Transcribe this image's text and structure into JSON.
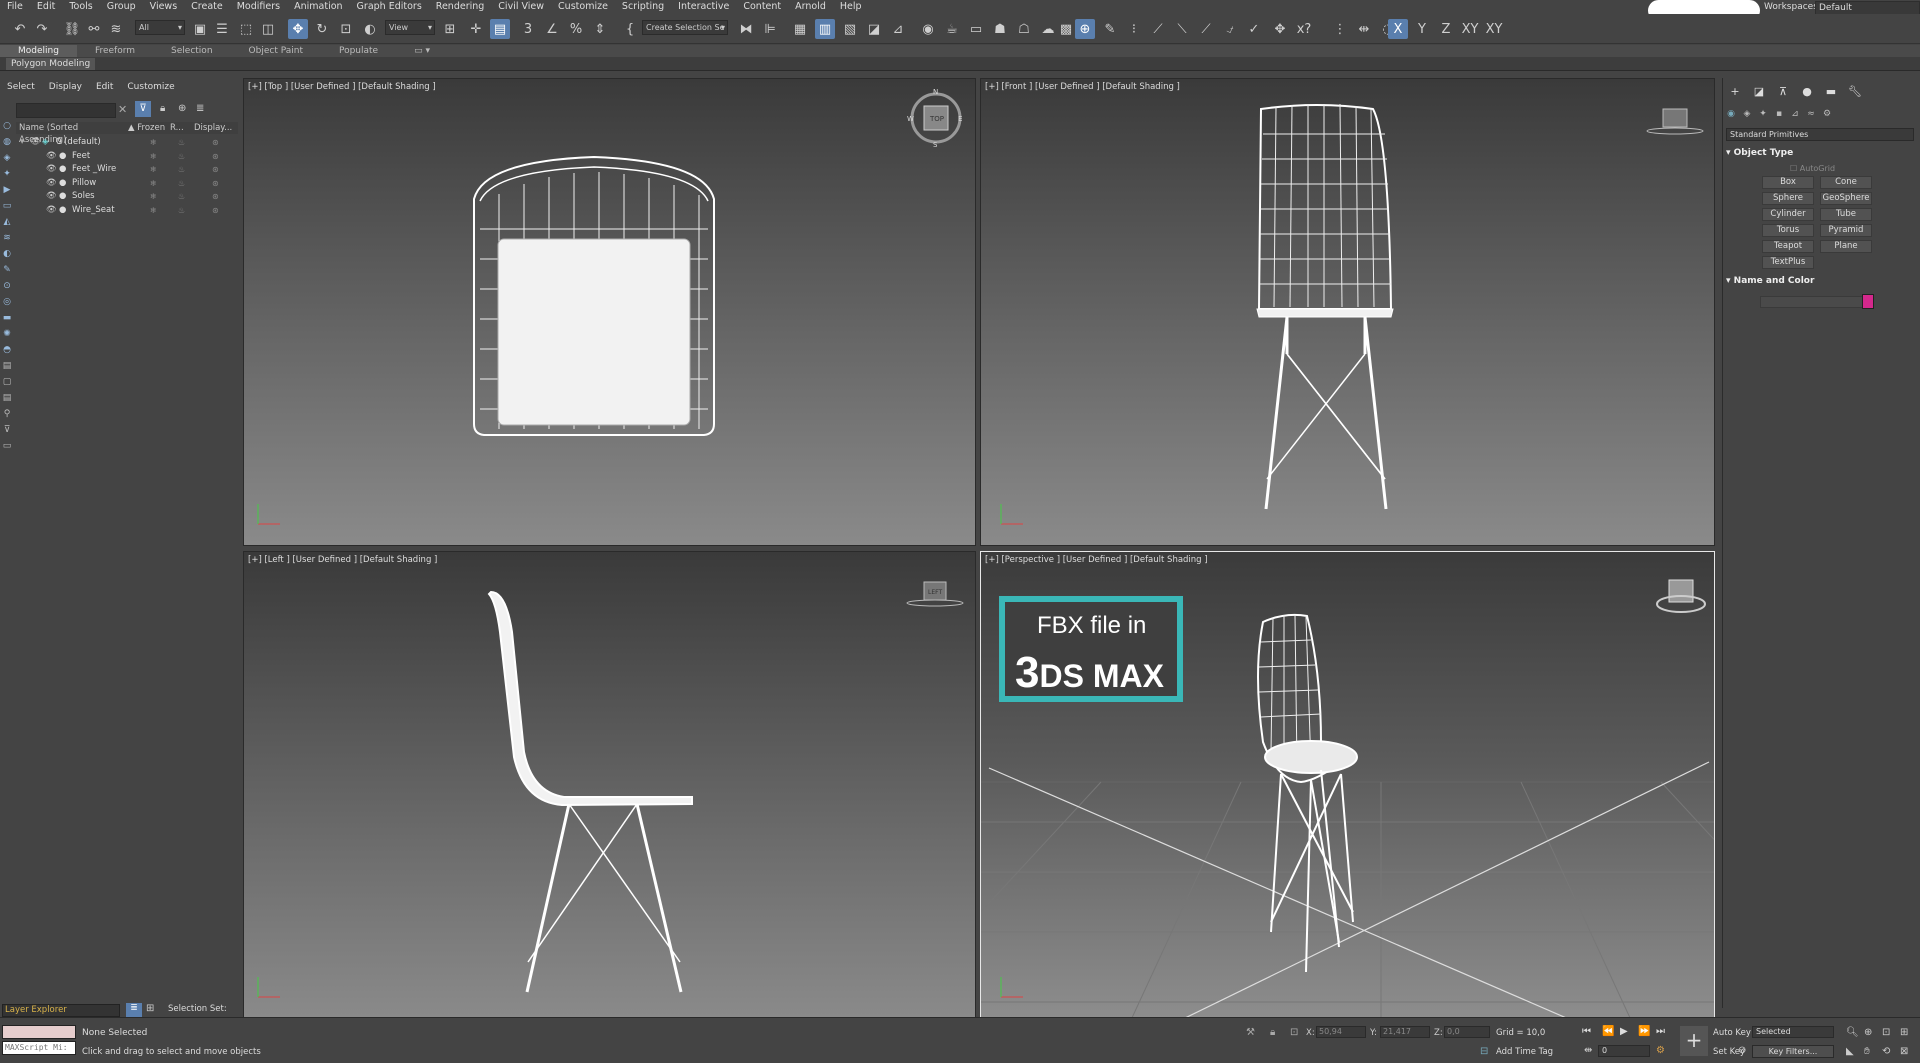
{
  "menu": [
    "File",
    "Edit",
    "Tools",
    "Group",
    "Views",
    "Create",
    "Modifiers",
    "Animation",
    "Graph Editors",
    "Rendering",
    "Civil View",
    "Customize",
    "Scripting",
    "Interactive",
    "Content",
    "Arnold",
    "Help"
  ],
  "workspaces_label": "Workspaces:",
  "workspace_value": "Default",
  "toolbar": {
    "selection_filter": "All",
    "ref_coord": "View",
    "selection_set": "Create Selection Se",
    "axis_x": "X",
    "axis_y": "Y",
    "axis_z": "Z",
    "axis_xy": "XY",
    "axis_xy2": "XY"
  },
  "ribbon": {
    "tabs": [
      "Modeling",
      "Freeform",
      "Selection",
      "Object Paint",
      "Populate"
    ],
    "sub_label": "Polygon Modeling"
  },
  "scene_explorer": {
    "menu": [
      "Select",
      "Display",
      "Edit",
      "Customize"
    ],
    "columns": [
      "Name (Sorted Ascending)",
      "▲ Frozen",
      "R...",
      "Display..."
    ],
    "rows": [
      {
        "name": "0 (default)"
      },
      {
        "name": "Feet"
      },
      {
        "name": "Feet _Wire"
      },
      {
        "name": "Pillow"
      },
      {
        "name": "Soles"
      },
      {
        "name": "Wire_Seat"
      }
    ],
    "layer_explorer": "Layer Explorer",
    "selection_set_label": "Selection Set:"
  },
  "viewports": {
    "top": "[+] [Top ] [User Defined ] [Default Shading ]",
    "front": "[+] [Front ] [User Defined ] [Default Shading ]",
    "left": "[+] [Left ] [User Defined ] [Default Shading ]",
    "perspective": "[+] [Perspective ] [User Defined ] [Default Shading ]",
    "viewcube_top": "TOP",
    "viewcube_left": "LEFT",
    "compass": [
      "N",
      "S",
      "E",
      "W"
    ]
  },
  "overlay": {
    "line1": "FBX file in",
    "line2_big": "3",
    "line2_rest": "DS MAX",
    "border_color": "#3ab7b7"
  },
  "command_panel": {
    "dropdown": "Standard Primitives",
    "object_type": "Object Type",
    "autogrid": "AutoGrid",
    "primitives": [
      "Box",
      "Cone",
      "Sphere",
      "GeoSphere",
      "Cylinder",
      "Tube",
      "Torus",
      "Pyramid",
      "Teapot",
      "Plane",
      "TextPlus"
    ],
    "name_and_color": "Name and Color",
    "swatch_color": "#d4288c"
  },
  "status": {
    "maxscript": "MAXScript Mi:",
    "none_selected": "None Selected",
    "hint": "Click and drag to select and move objects",
    "x_label": "X:",
    "x_value": "50,94",
    "y_label": "Y:",
    "y_value": "21,417",
    "z_label": "Z:",
    "z_value": "0,0",
    "grid": "Grid = 10,0",
    "add_time_tag": "Add Time Tag",
    "auto_key": "Auto Key",
    "set_key": "Set Key",
    "selected": "Selected",
    "key_filters": "Key Filters...",
    "frame": "0"
  }
}
